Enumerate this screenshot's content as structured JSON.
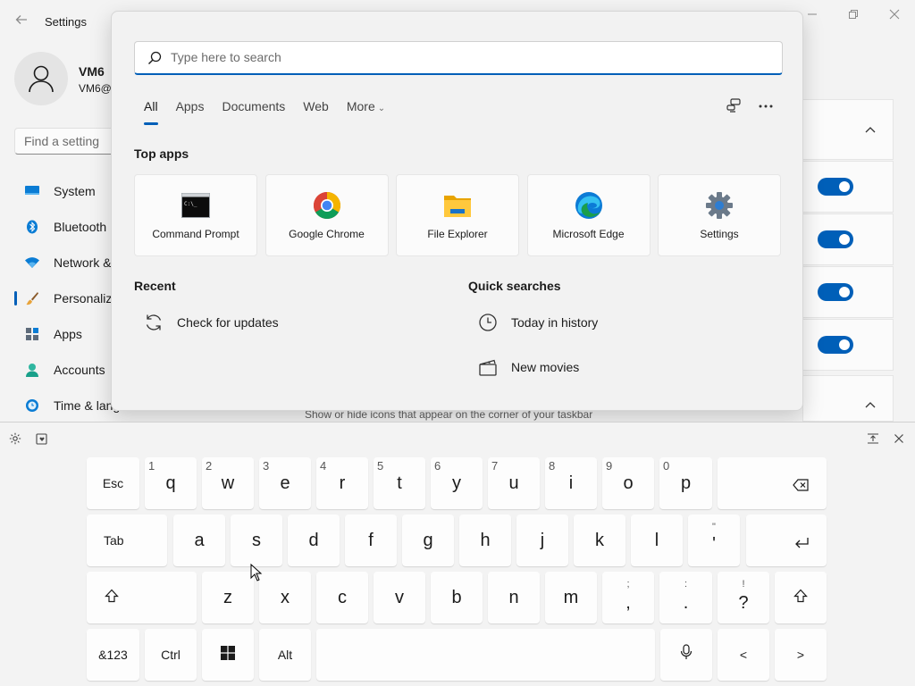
{
  "settings": {
    "title": "Settings",
    "user": {
      "name": "VM6",
      "email": "VM6@"
    },
    "search_placeholder": "Find a setting",
    "nav": [
      {
        "label": "System",
        "icon": "system-icon"
      },
      {
        "label": "Bluetooth",
        "icon": "bluetooth-icon"
      },
      {
        "label": "Network &",
        "icon": "network-icon"
      },
      {
        "label": "Personaliza",
        "icon": "personalization-brush-icon",
        "selected": true
      },
      {
        "label": "Apps",
        "icon": "apps-icon"
      },
      {
        "label": "Accounts",
        "icon": "accounts-icon"
      },
      {
        "label": "Time & lang",
        "icon": "time-language-icon"
      }
    ],
    "taskbar_corner_hint": "Show or hide icons that appear on the corner of your taskbar",
    "toggles_on": [
      true,
      true,
      true,
      true
    ]
  },
  "search_flyout": {
    "search_placeholder": "Type here to search",
    "filters": [
      "All",
      "Apps",
      "Documents",
      "Web",
      "More"
    ],
    "active_filter": "All",
    "top_apps_title": "Top apps",
    "top_apps": [
      {
        "label": "Command Prompt",
        "icon": "command-prompt-icon"
      },
      {
        "label": "Google Chrome",
        "icon": "chrome-icon"
      },
      {
        "label": "File Explorer",
        "icon": "file-explorer-icon"
      },
      {
        "label": "Microsoft Edge",
        "icon": "edge-icon"
      },
      {
        "label": "Settings",
        "icon": "settings-gear-icon"
      }
    ],
    "recent_title": "Recent",
    "recent": [
      {
        "label": "Check for updates",
        "icon": "refresh-icon"
      }
    ],
    "quick_searches_title": "Quick searches",
    "quick_searches": [
      {
        "label": "Today in history",
        "icon": "clock-icon"
      },
      {
        "label": "New movies",
        "icon": "clapperboard-icon"
      }
    ]
  },
  "keyboard": {
    "row1": [
      {
        "label": "Esc"
      },
      {
        "label": "q",
        "hint": "1"
      },
      {
        "label": "w",
        "hint": "2"
      },
      {
        "label": "e",
        "hint": "3"
      },
      {
        "label": "r",
        "hint": "4"
      },
      {
        "label": "t",
        "hint": "5"
      },
      {
        "label": "y",
        "hint": "6"
      },
      {
        "label": "u",
        "hint": "7"
      },
      {
        "label": "i",
        "hint": "8"
      },
      {
        "label": "o",
        "hint": "9"
      },
      {
        "label": "p",
        "hint": "0"
      }
    ],
    "row2": [
      {
        "label": "Tab"
      },
      {
        "label": "a"
      },
      {
        "label": "s"
      },
      {
        "label": "d"
      },
      {
        "label": "f"
      },
      {
        "label": "g"
      },
      {
        "label": "h"
      },
      {
        "label": "j"
      },
      {
        "label": "k"
      },
      {
        "label": "l"
      },
      {
        "label": "'",
        "alt": "\""
      }
    ],
    "row3": [
      {
        "label": "z"
      },
      {
        "label": "x"
      },
      {
        "label": "c"
      },
      {
        "label": "v"
      },
      {
        "label": "b"
      },
      {
        "label": "n"
      },
      {
        "label": "m"
      },
      {
        "label": ",",
        "alt": ";"
      },
      {
        "label": ".",
        "alt": ":"
      },
      {
        "label": "?",
        "alt": "!"
      }
    ],
    "row4": [
      {
        "label": "&123"
      },
      {
        "label": "Ctrl"
      },
      {
        "label": "Alt"
      },
      {
        "label": "<"
      },
      {
        "label": ">"
      }
    ]
  },
  "colors": {
    "accent": "#005fb8"
  }
}
